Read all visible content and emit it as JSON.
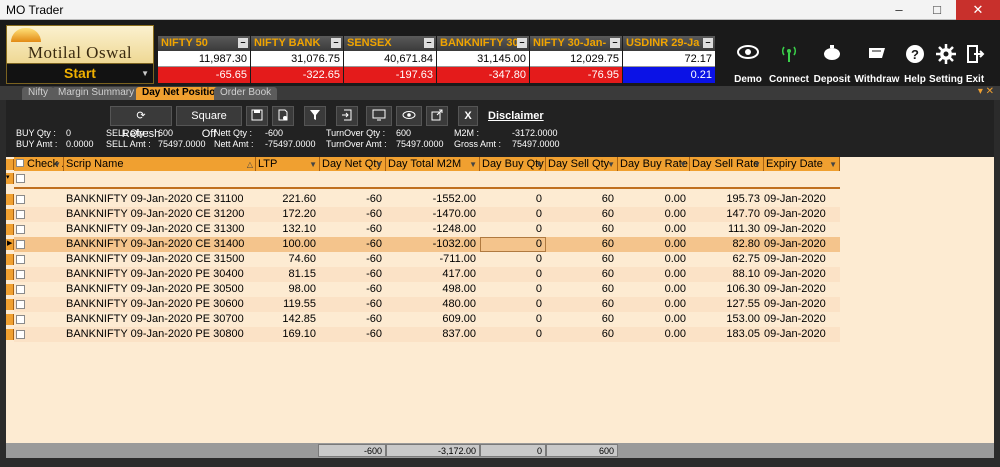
{
  "window": {
    "title": "MO Trader",
    "minimize": "–",
    "maximize": "□",
    "close": "✕"
  },
  "brand": {
    "name": "Motilal Oswal",
    "start_label": "Start"
  },
  "tickers": [
    {
      "name": "NIFTY 50",
      "value": "11,987.30",
      "change": "-65.65",
      "color": "red"
    },
    {
      "name": "NIFTY BANK",
      "value": "31,076.75",
      "change": "-322.65",
      "color": "red"
    },
    {
      "name": "SENSEX",
      "value": "40,671.84",
      "change": "-197.63",
      "color": "red"
    },
    {
      "name": "BANKNIFTY 30",
      "value": "31,145.00",
      "change": "-347.80",
      "color": "red"
    },
    {
      "name": "NIFTY 30-Jan-",
      "value": "12,029.75",
      "change": "-76.95",
      "color": "red"
    },
    {
      "name": "USDINR 29-Ja",
      "value": "72.17",
      "change": "0.21",
      "color": "blue"
    }
  ],
  "tools": [
    {
      "label": "Demo",
      "icon": "eye-icon"
    },
    {
      "label": "Connect",
      "icon": "antenna-icon"
    },
    {
      "label": "Deposit",
      "icon": "piggy-bank-icon"
    },
    {
      "label": "Withdraw",
      "icon": "withdraw-icon"
    },
    {
      "label": "Help",
      "icon": "help-icon"
    },
    {
      "label": "Setting",
      "icon": "gear-icon"
    },
    {
      "label": "Exit",
      "icon": "exit-icon"
    }
  ],
  "tabs": [
    {
      "label": "Nifty",
      "active": false
    },
    {
      "label": "Margin Summary",
      "active": false
    },
    {
      "label": "Day Net Position",
      "active": true
    },
    {
      "label": "Order Book",
      "active": false
    }
  ],
  "toolbar": {
    "refresh": "Refresh",
    "square_off": "Square Off",
    "close_x": "X",
    "disclaimer": "Disclaimer"
  },
  "stats": {
    "buy_qty_label": "BUY Qty :",
    "buy_qty": "0",
    "buy_amt_label": "BUY Amt :",
    "buy_amt": "0.0000",
    "sell_qty_label": "SELL Qty :",
    "sell_qty": "600",
    "sell_amt_label": "SELL Amt :",
    "sell_amt": "75497.0000",
    "nett_qty_label": "Nett Qty :",
    "nett_qty": "-600",
    "nett_amt_label": "Nett Amt :",
    "nett_amt": "-75497.0000",
    "turnover_qty_label": "TurnOver Qty :",
    "turnover_qty": "600",
    "turnover_amt_label": "TurnOver Amt :",
    "turnover_amt": "75497.0000",
    "m2m_label": "M2M :",
    "m2m": "-3172.0000",
    "gross_amt_label": "Gross Amt :",
    "gross_amt": "75497.0000"
  },
  "columns": [
    "Check ...",
    "Scrip Name",
    "LTP",
    "Day Net Qty",
    "Day Total M2M",
    "Day Buy Qty",
    "Day Sell Qty",
    "Day Buy Rate",
    "Day Sell Rate",
    "Expiry Date"
  ],
  "rows": [
    {
      "scrip": "BANKNIFTY 09-Jan-2020 CE 31100",
      "ltp": "221.60",
      "net_qty": "-60",
      "m2m": "-1552.00",
      "buy_qty": "0",
      "sell_qty": "60",
      "buy_rate": "0.00",
      "sell_rate": "195.73",
      "expiry": "09-Jan-2020"
    },
    {
      "scrip": "BANKNIFTY 09-Jan-2020 CE 31200",
      "ltp": "172.20",
      "net_qty": "-60",
      "m2m": "-1470.00",
      "buy_qty": "0",
      "sell_qty": "60",
      "buy_rate": "0.00",
      "sell_rate": "147.70",
      "expiry": "09-Jan-2020"
    },
    {
      "scrip": "BANKNIFTY 09-Jan-2020 CE 31300",
      "ltp": "132.10",
      "net_qty": "-60",
      "m2m": "-1248.00",
      "buy_qty": "0",
      "sell_qty": "60",
      "buy_rate": "0.00",
      "sell_rate": "111.30",
      "expiry": "09-Jan-2020"
    },
    {
      "scrip": "BANKNIFTY 09-Jan-2020 CE 31400",
      "ltp": "100.00",
      "net_qty": "-60",
      "m2m": "-1032.00",
      "buy_qty": "0",
      "sell_qty": "60",
      "buy_rate": "0.00",
      "sell_rate": "82.80",
      "expiry": "09-Jan-2020"
    },
    {
      "scrip": "BANKNIFTY 09-Jan-2020 CE 31500",
      "ltp": "74.60",
      "net_qty": "-60",
      "m2m": "-711.00",
      "buy_qty": "0",
      "sell_qty": "60",
      "buy_rate": "0.00",
      "sell_rate": "62.75",
      "expiry": "09-Jan-2020"
    },
    {
      "scrip": "BANKNIFTY 09-Jan-2020 PE 30400",
      "ltp": "81.15",
      "net_qty": "-60",
      "m2m": "417.00",
      "buy_qty": "0",
      "sell_qty": "60",
      "buy_rate": "0.00",
      "sell_rate": "88.10",
      "expiry": "09-Jan-2020"
    },
    {
      "scrip": "BANKNIFTY 09-Jan-2020 PE 30500",
      "ltp": "98.00",
      "net_qty": "-60",
      "m2m": "498.00",
      "buy_qty": "0",
      "sell_qty": "60",
      "buy_rate": "0.00",
      "sell_rate": "106.30",
      "expiry": "09-Jan-2020"
    },
    {
      "scrip": "BANKNIFTY 09-Jan-2020 PE 30600",
      "ltp": "119.55",
      "net_qty": "-60",
      "m2m": "480.00",
      "buy_qty": "0",
      "sell_qty": "60",
      "buy_rate": "0.00",
      "sell_rate": "127.55",
      "expiry": "09-Jan-2020"
    },
    {
      "scrip": "BANKNIFTY 09-Jan-2020 PE 30700",
      "ltp": "142.85",
      "net_qty": "-60",
      "m2m": "609.00",
      "buy_qty": "0",
      "sell_qty": "60",
      "buy_rate": "0.00",
      "sell_rate": "153.00",
      "expiry": "09-Jan-2020"
    },
    {
      "scrip": "BANKNIFTY 09-Jan-2020 PE 30800",
      "ltp": "169.10",
      "net_qty": "-60",
      "m2m": "837.00",
      "buy_qty": "0",
      "sell_qty": "60",
      "buy_rate": "0.00",
      "sell_rate": "183.05",
      "expiry": "09-Jan-2020"
    }
  ],
  "selected_row_index": 3,
  "totals": {
    "net_qty": "-600",
    "m2m": "-3,172.00",
    "buy_qty": "0",
    "sell_qty": "600"
  },
  "colors": {
    "accent": "#f0a030",
    "loss": "#e41b1b",
    "gain_fx": "#0b12e6",
    "grid_bg": "#fdebd2"
  }
}
